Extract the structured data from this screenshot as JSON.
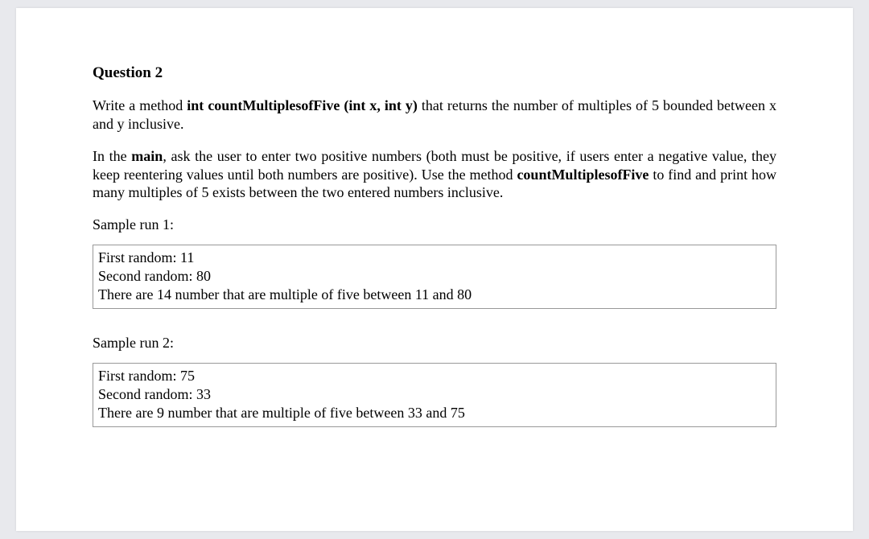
{
  "question": {
    "title": "Question 2",
    "para1_pre": "Write a method ",
    "para1_bold": "int countMultiplesofFive (int x, int y)",
    "para1_post": " that returns the number of multiples of 5 bounded between x and y inclusive.",
    "para2_pre": "In the ",
    "para2_bold1": "main",
    "para2_mid": ", ask the user to enter two positive numbers (both must be positive, if users enter a negative value, they keep reentering values until both numbers are positive). Use the method ",
    "para2_bold2": "countMultiplesofFive",
    "para2_post": " to find and print how many multiples of 5 exists between the two entered numbers inclusive.",
    "sample1_label": "Sample run 1:",
    "sample1_line1": "First random: 11",
    "sample1_line2": "Second random: 80",
    "sample1_line3": "There are 14 number that are multiple of five between 11 and 80",
    "sample2_label": "Sample run 2:",
    "sample2_line1": "First random: 75",
    "sample2_line2": "Second random: 33",
    "sample2_line3": "There are 9 number that are multiple of five between 33 and 75"
  }
}
